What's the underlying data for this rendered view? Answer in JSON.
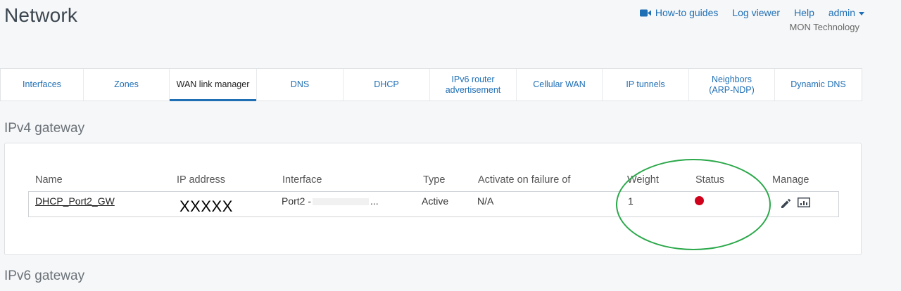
{
  "header": {
    "title": "Network",
    "org_name": "MON Technology",
    "nav": {
      "howto": "How-to guides",
      "logviewer": "Log viewer",
      "help": "Help",
      "user": "admin"
    },
    "icons": {
      "video": "video-camera-icon",
      "user_caret": "chevron-down-icon"
    }
  },
  "tabs": [
    {
      "label": "Interfaces",
      "active": false
    },
    {
      "label": "Zones",
      "active": false
    },
    {
      "label": "WAN link manager",
      "active": true
    },
    {
      "label": "DNS",
      "active": false
    },
    {
      "label": "DHCP",
      "active": false
    },
    {
      "label": "IPv6 router advertisement",
      "active": false
    },
    {
      "label": "Cellular WAN",
      "active": false
    },
    {
      "label": "IP tunnels",
      "active": false
    },
    {
      "label": "Neighbors (ARP-NDP)",
      "active": false
    },
    {
      "label": "Dynamic DNS",
      "active": false
    }
  ],
  "ipv4": {
    "title": "IPv4 gateway",
    "columns": {
      "name": "Name",
      "ip": "IP address",
      "interface": "Interface",
      "type": "Type",
      "activate": "Activate on failure of",
      "weight": "Weight",
      "status": "Status",
      "manage": "Manage"
    },
    "rows": [
      {
        "name": "DHCP_Port2_GW",
        "ip": "XXXXX",
        "interface_prefix": "Port2 -",
        "interface_suffix": "...",
        "type": "Active",
        "activate": "N/A",
        "weight": "1",
        "status_color": "#d0021b"
      }
    ],
    "icons": {
      "edit": "pencil-icon",
      "chart": "bar-chart-icon"
    }
  },
  "ipv6": {
    "title": "IPv6 gateway"
  },
  "colors": {
    "accent": "#1f6fb5",
    "annotation": "#2ba84a",
    "status_down": "#d0021b"
  }
}
